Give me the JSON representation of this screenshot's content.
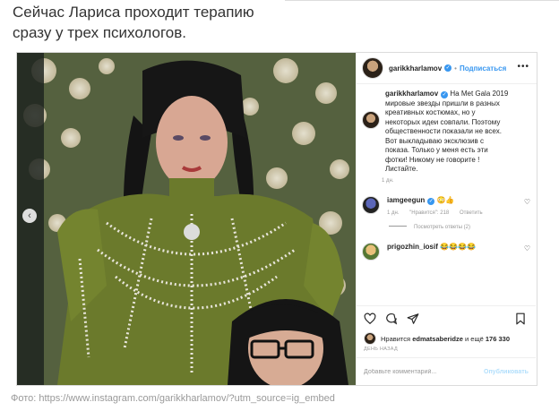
{
  "article": {
    "line1": "Сейчас Лариса проходит терапию",
    "line2": "сразу у трех психологов."
  },
  "post": {
    "username": "garikkharlamov",
    "follow_label": "Подписаться",
    "more_label": "•••",
    "caption_lines": [
      "На Met Gala 2019",
      "мировые звезды пришли в разных",
      "креативных костюмах, но у",
      "некоторых идеи совпали. Поэтому",
      "общественности показали не всех.",
      "Вот выкладываю эксклюзив с",
      "показа. Только у меня есть эти",
      "фотки! Никому не говорите !",
      "Листайте."
    ],
    "caption_age": "1 дн.",
    "comments": [
      {
        "username": "iamgeegun",
        "text": "😳👍",
        "age": "1 дн.",
        "likes": "\"Нравится\": 218",
        "reply": "Ответить",
        "view_replies": "Посмотреть ответы (2)"
      },
      {
        "username": "prigozhin_iosif",
        "text": "😂😂😂😂"
      }
    ],
    "likes_prefix": "Нравится",
    "likes_user": "edmatsaberidze",
    "likes_and": "и ещё",
    "likes_count": "176 330",
    "date": "ДЕНЬ НАЗАД",
    "comment_placeholder": "Добавьте комментарий...",
    "publish_label": "Опубликовать",
    "nav_prev": "‹"
  },
  "source": "Фото: https://www.instagram.com/garikkharlamov/?utm_source=ig_embed",
  "colors": {
    "accent": "#3897f0",
    "dress": "#6b7a2c",
    "border": "#dbdbdb"
  }
}
